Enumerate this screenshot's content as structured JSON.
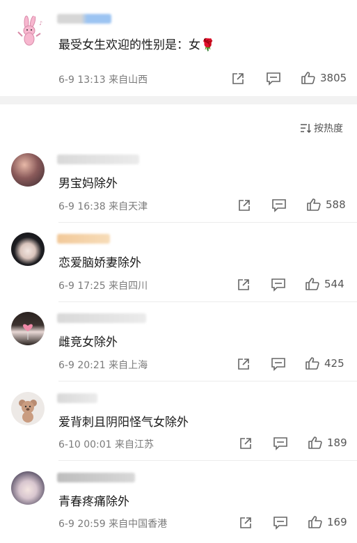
{
  "post": {
    "text": "最受女生欢迎的性别是：女🌹",
    "date": "6-9 13:13",
    "location": "来自山西",
    "likes": "3805"
  },
  "sort_label": "按热度",
  "comments": [
    {
      "text": "男宝妈除外",
      "date": "6-9 16:38",
      "location": "来自天津",
      "likes": "588"
    },
    {
      "text": "恋爱脑娇妻除外",
      "date": "6-9 17:25",
      "location": "来自四川",
      "likes": "544"
    },
    {
      "text": "雌竞女除外",
      "date": "6-9 20:21",
      "location": "来自上海",
      "likes": "425"
    },
    {
      "text": "爱背刺且阴阳怪气女除外",
      "date": "6-10 00:01",
      "location": "来自江苏",
      "likes": "189"
    },
    {
      "text": "青春疼痛除外",
      "date": "6-9 20:59",
      "location": "来自中国香港",
      "likes": "169"
    }
  ],
  "icons": {
    "share": "share-icon",
    "comment": "comment-icon",
    "like": "thumbs-up-icon",
    "sort": "sort-icon"
  },
  "colors": {
    "accent_username": "#8fb8f0",
    "meta_text": "#7a7a7a",
    "separator": "#f2f2f2"
  }
}
